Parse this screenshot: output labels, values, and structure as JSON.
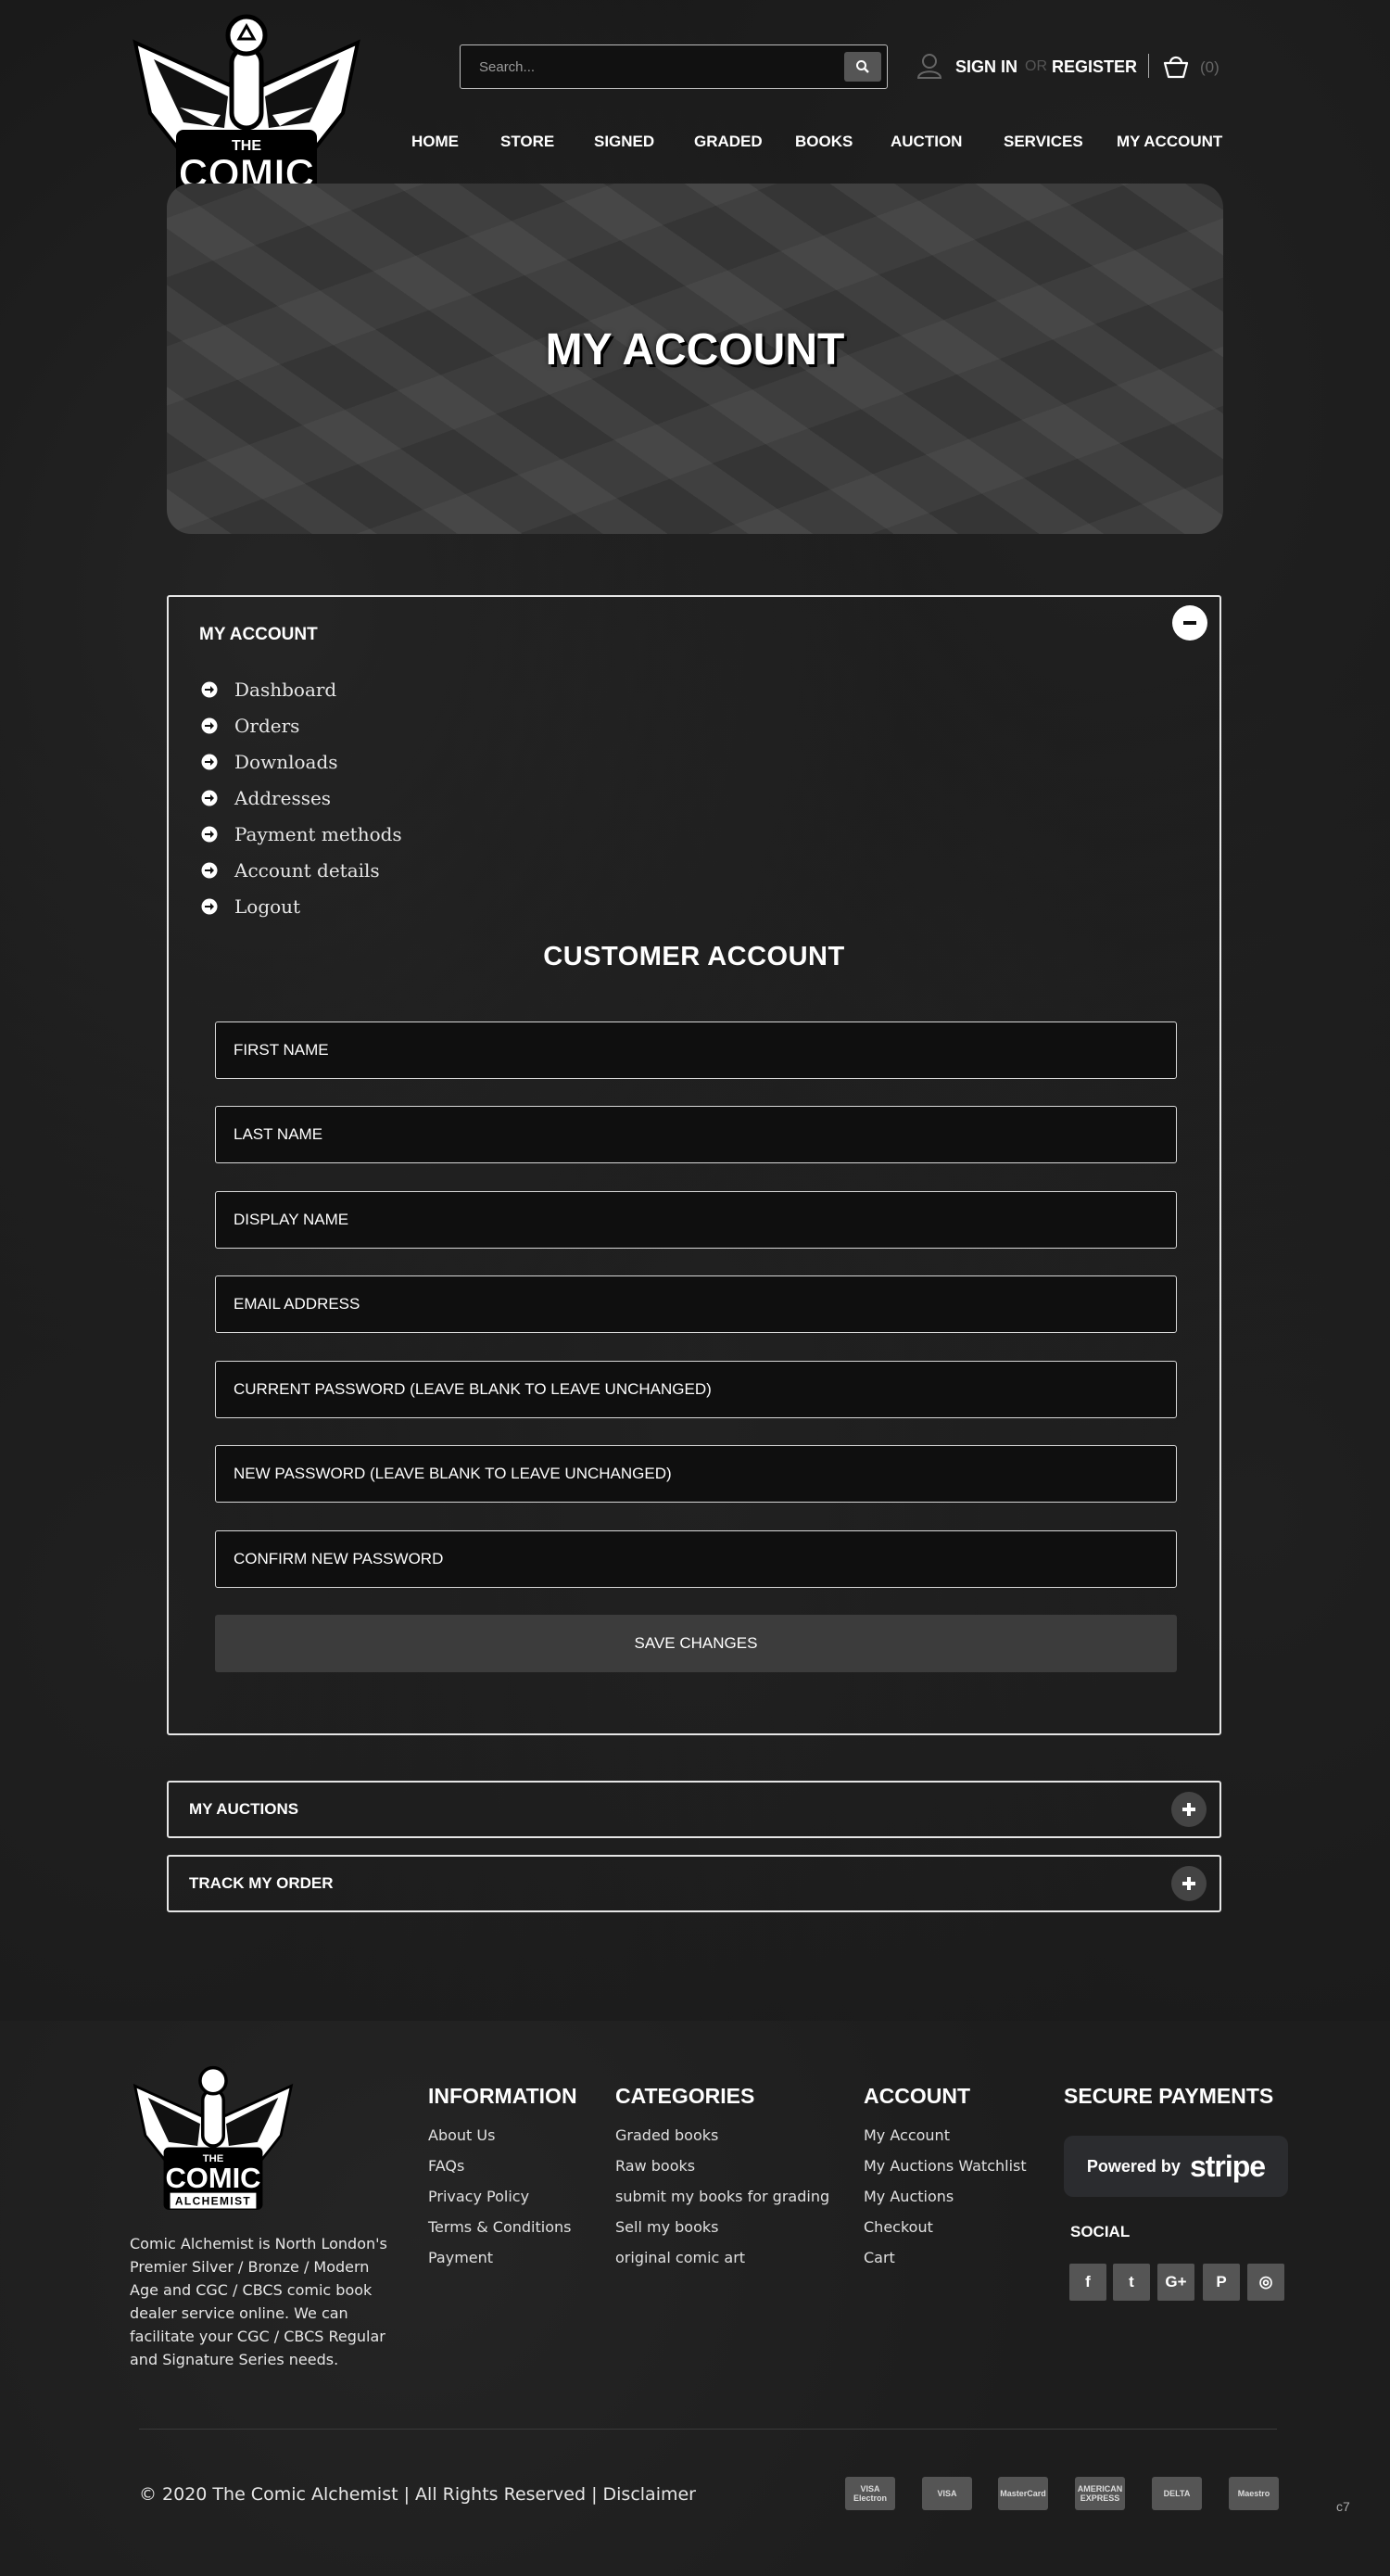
{
  "header": {
    "logo_lines": [
      "THE",
      "COMIC",
      "ALCHEMIST"
    ],
    "search_placeholder": "Search...",
    "sign_in": "SIGN IN",
    "or": "OR",
    "register": "REGISTER",
    "cart_count": "(0)"
  },
  "nav": [
    "HOME",
    "STORE",
    "SIGNED",
    "GRADED",
    "BOOKS",
    "AUCTION",
    "SERVICES",
    "MY ACCOUNT"
  ],
  "hero": {
    "title": "MY ACCOUNT"
  },
  "account_panel": {
    "title": "MY ACCOUNT",
    "menu": [
      "Dashboard",
      "Orders",
      "Downloads",
      "Addresses",
      "Payment methods",
      "Account details",
      "Logout"
    ],
    "form_title": "CUSTOMER ACCOUNT",
    "fields": [
      "FIRST NAME",
      "LAST NAME",
      "DISPLAY NAME",
      "EMAIL ADDRESS",
      "CURRENT PASSWORD (LEAVE BLANK TO LEAVE UNCHANGED)",
      "NEW PASSWORD (LEAVE BLANK TO LEAVE UNCHANGED)",
      "CONFIRM NEW PASSWORD"
    ],
    "save_label": "SAVE CHANGES"
  },
  "auctions_panel": {
    "title": "MY AUCTIONS"
  },
  "track_panel": {
    "title": "TRACK MY ORDER"
  },
  "footer": {
    "about": "Comic Alchemist is North London's Premier Silver / Bronze / Modern Age and CGC / CBCS comic book dealer service online. We can facilitate your CGC / CBCS Regular and Signature Series needs.",
    "information": {
      "title": "INFORMATION",
      "links": [
        "About Us",
        "FAQs",
        "Privacy Policy",
        "Terms & Conditions",
        "Payment"
      ]
    },
    "categories": {
      "title": "CATEGORIES",
      "links": [
        "Graded books",
        "Raw books",
        "submit my books for grading",
        "Sell my books",
        "original comic art"
      ]
    },
    "account": {
      "title": "ACCOUNT",
      "links": [
        "My Account",
        "My Auctions Watchlist",
        "My Auctions",
        "Checkout",
        "Cart"
      ]
    },
    "payments": {
      "title": "SECURE PAYMENTS",
      "powered_by": "Powered by",
      "stripe": "stripe"
    },
    "social_title": "SOCIAL",
    "social_icons": [
      "facebook-icon",
      "twitter-icon",
      "google-plus-icon",
      "pinterest-icon",
      "instagram-icon"
    ],
    "social_glyphs": [
      "f",
      "t",
      "G+",
      "P",
      "◎"
    ],
    "copyright": "© 2020 The Comic Alchemist | All Rights Reserved | Disclaimer",
    "payment_cards": [
      "VISA Electron",
      "VISA",
      "MasterCard",
      "AMERICAN EXPRESS",
      "DELTA",
      "Maestro"
    ],
    "corner_tag": "c7"
  }
}
